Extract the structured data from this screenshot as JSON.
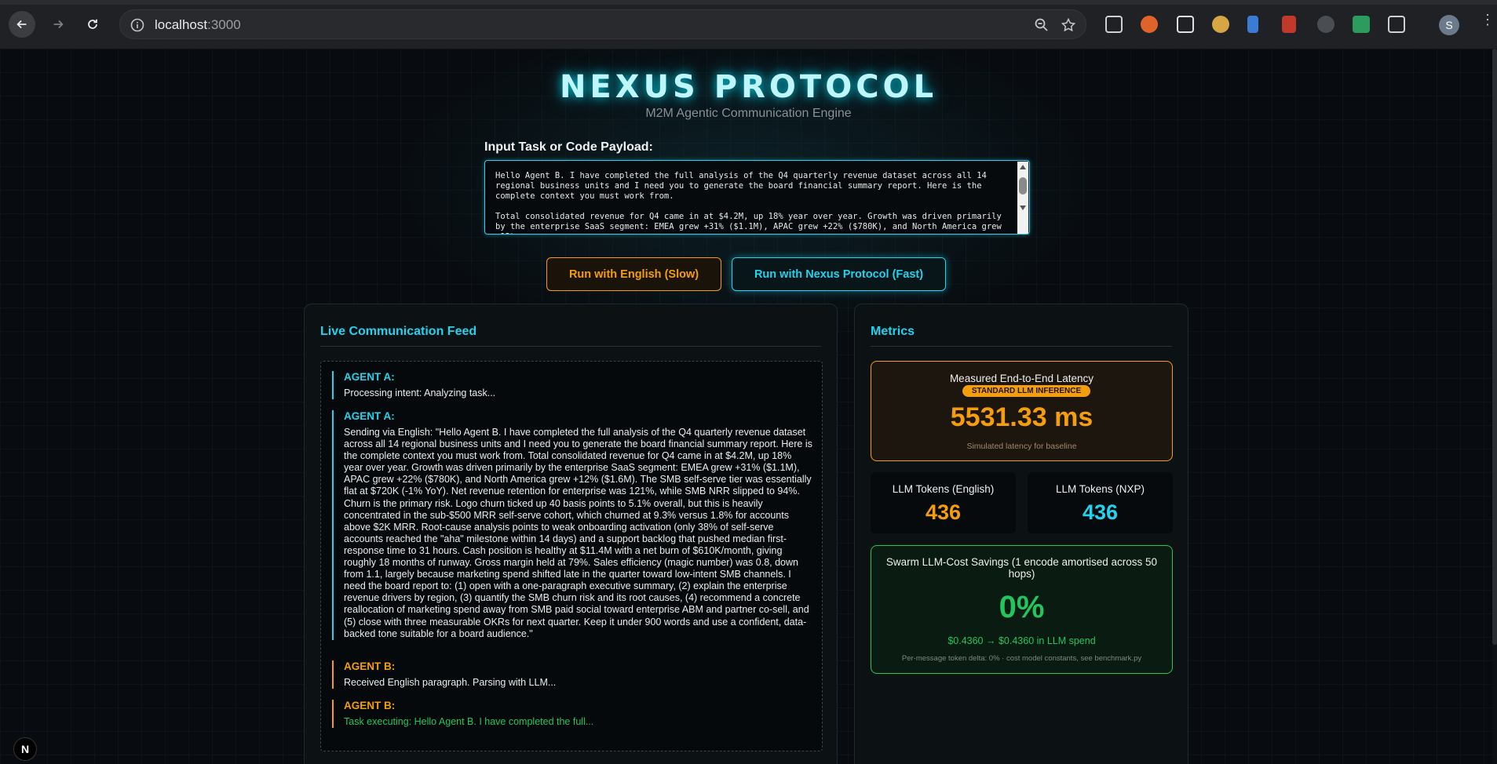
{
  "browser": {
    "url_host": "localhost",
    "url_port": ":3000",
    "profile_initial": "S"
  },
  "header": {
    "title": "NEXUS PROTOCOL",
    "subtitle": "M2M Agentic Communication Engine"
  },
  "input": {
    "label": "Input Task or Code Payload:",
    "value": "Hello Agent B. I have completed the full analysis of the Q4 quarterly revenue dataset across all 14 regional business units and I need you to generate the board financial summary report. Here is the complete context you must work from.\n\nTotal consolidated revenue for Q4 came in at $4.2M, up 18% year over year. Growth was driven primarily by the enterprise SaaS segment: EMEA grew +31% ($1.1M), APAC grew +22% ($780K), and North America grew +12%"
  },
  "actions": {
    "english_label": "Run with English (Slow)",
    "nexus_label": "Run with Nexus Protocol (Fast)"
  },
  "feed": {
    "title": "Live Communication Feed",
    "messages": [
      {
        "agent": "AGENT A:",
        "text": "Processing intent: Analyzing task..."
      },
      {
        "agent": "AGENT A:",
        "text": "Sending via English: \"Hello Agent B. I have completed the full analysis of the Q4 quarterly revenue dataset across all 14 regional business units and I need you to generate the board financial summary report. Here is the complete context you must work from. Total consolidated revenue for Q4 came in at $4.2M, up 18% year over year. Growth was driven primarily by the enterprise SaaS segment: EMEA grew +31% ($1.1M), APAC grew +22% ($780K), and North America grew +12% ($1.6M). The SMB self-serve tier was essentially flat at $720K (-1% YoY). Net revenue retention for enterprise was 121%, while SMB NRR slipped to 94%. Churn is the primary risk. Logo churn ticked up 40 basis points to 5.1% overall, but this is heavily concentrated in the sub-$500 MRR self-serve cohort, which churned at 9.3% versus 1.8% for accounts above $2K MRR. Root-cause analysis points to weak onboarding activation (only 38% of self-serve accounts reached the \"aha\" milestone within 14 days) and a support backlog that pushed median first-response time to 31 hours. Cash position is healthy at $11.4M with a net burn of $610K/month, giving roughly 18 months of runway. Gross margin held at 79%. Sales efficiency (magic number) was 0.8, down from 1.1, largely because marketing spend shifted late in the quarter toward low-intent SMB channels. I need the board report to: (1) open with a one-paragraph executive summary, (2) explain the enterprise revenue drivers by region, (3) quantify the SMB churn risk and its root causes, (4) recommend a concrete reallocation of marketing spend away from SMB paid social toward enterprise ABM and partner co-sell, and (5) close with three measurable OKRs for next quarter. Keep it under 900 words and use a confident, data-backed tone suitable for a board audience.\""
      },
      {
        "agent": "AGENT B:",
        "text": "Received English paragraph. Parsing with LLM..."
      },
      {
        "agent": "AGENT B:",
        "text": "Task executing: Hello Agent B. I have completed the full..."
      }
    ]
  },
  "metrics": {
    "title": "Metrics",
    "latency": {
      "label": "Measured End-to-End Latency",
      "badge": "STANDARD LLM INFERENCE",
      "value": "5531.33 ms",
      "note": "Simulated latency for baseline"
    },
    "tokens_english": {
      "label": "LLM Tokens (English)",
      "value": "436"
    },
    "tokens_nxp": {
      "label": "LLM Tokens (NXP)",
      "value": "436"
    },
    "savings": {
      "label": "Swarm LLM-Cost Savings (1 encode amortised across 50 hops)",
      "value": "0%",
      "spend": "$0.4360 → $0.4360 in LLM spend",
      "delta": "Per-message token delta: 0% · cost model constants, see benchmark.py"
    }
  },
  "dev_badge": "N",
  "colors": {
    "accent_cyan": "#22d3ee",
    "accent_orange": "#f59e0b",
    "accent_green": "#22c55e"
  }
}
